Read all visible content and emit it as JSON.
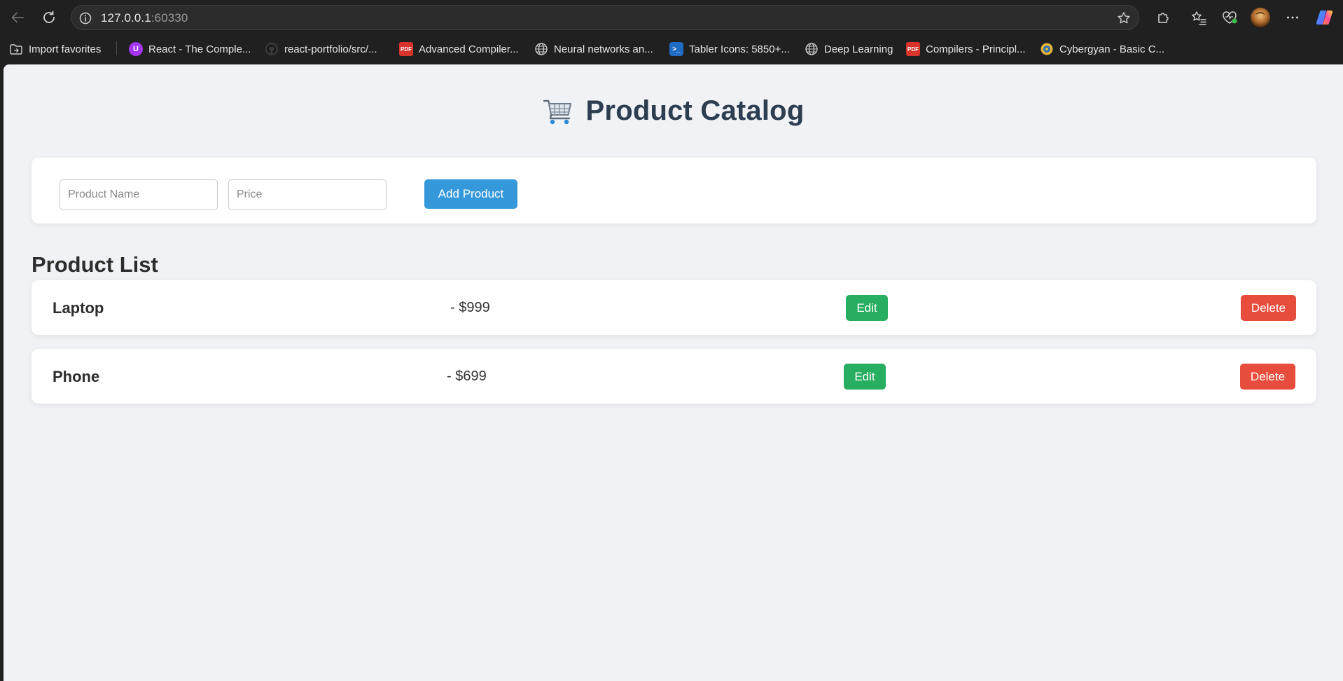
{
  "browser": {
    "url_host": "127.0.0.1",
    "url_port": ":60330",
    "bookmarks": [
      {
        "label": "Import favorites",
        "icon": "folder-import-icon"
      },
      {
        "label": "React - The Comple...",
        "icon": "udemy-icon",
        "color": "#a435f0"
      },
      {
        "label": "react-portfolio/src/...",
        "icon": "github-icon"
      },
      {
        "label": "Advanced Compiler...",
        "icon": "pdf-icon",
        "color": "#d9342b"
      },
      {
        "label": "Neural networks an...",
        "icon": "globe-icon"
      },
      {
        "label": "Tabler Icons: 5850+...",
        "icon": "tabler-icon",
        "color": "#206bc4"
      },
      {
        "label": "Deep Learning",
        "icon": "globe-icon"
      },
      {
        "label": "Compilers - Principl...",
        "icon": "pdf-icon",
        "color": "#d9342b"
      },
      {
        "label": "Cybergyan - Basic C...",
        "icon": "cybergyan-icon",
        "color": "#e2b43a"
      }
    ]
  },
  "page": {
    "title": "Product Catalog",
    "title_icon": "shopping-cart-icon",
    "form": {
      "name_placeholder": "Product Name",
      "price_placeholder": "Price",
      "add_label": "Add Product"
    },
    "list_heading": "Product List",
    "products": [
      {
        "name": "Laptop",
        "price": "- $999",
        "edit_label": "Edit",
        "delete_label": "Delete"
      },
      {
        "name": "Phone",
        "price": "- $699",
        "edit_label": "Edit",
        "delete_label": "Delete"
      }
    ]
  },
  "colors": {
    "add_button": "#3498db",
    "edit_button": "#27ae60",
    "delete_button": "#e74c3c",
    "title_text": "#2c3e50",
    "page_background": "#f0f2f5"
  }
}
